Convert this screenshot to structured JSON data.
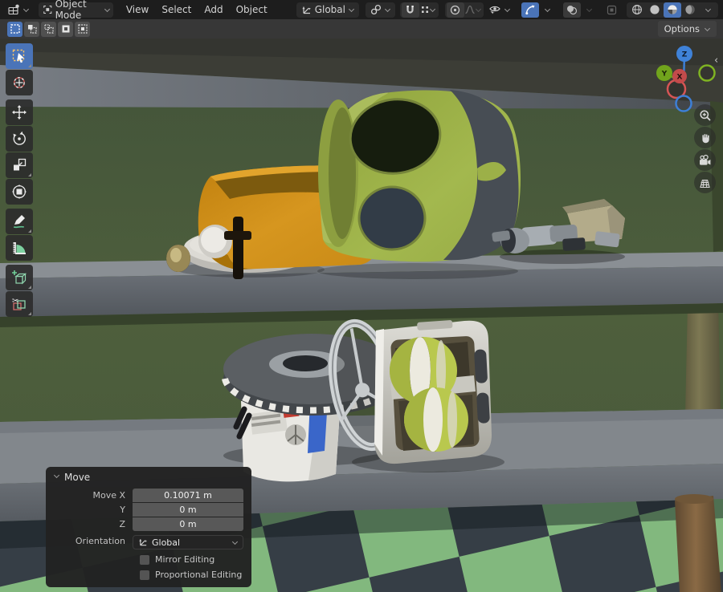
{
  "topbar": {
    "editor_icon": "3d-viewport-editor-icon",
    "mode_label": "Object Mode",
    "menus": [
      "View",
      "Select",
      "Add",
      "Object"
    ],
    "orientation_label": "Global",
    "icons": [
      "transform-orientation-icon",
      "snap-target-icon",
      "magnet-icon",
      "snap-individual-icon",
      "proportional-editing-icon",
      "falloff-curve-icon",
      "show-object-types-eye-icon",
      "gizmo-toggle-icon",
      "overlays-icon",
      "xray-toggle-icon",
      "shading-wireframe-icon",
      "shading-solid-icon",
      "shading-material-icon",
      "shading-rendered-icon"
    ]
  },
  "toolrow": {
    "options_label": "Options",
    "select_modes": [
      "set",
      "extend",
      "subtract",
      "invert",
      "intersect"
    ],
    "active_mode": "set"
  },
  "left_toolbar": {
    "tools": [
      "select-box",
      "cursor",
      "move",
      "rotate",
      "scale",
      "transform",
      "annotate",
      "measure",
      "add-cube",
      "cut"
    ],
    "active_tool": "select-box"
  },
  "gizmo": {
    "x": "X",
    "y": "Y",
    "z": "Z",
    "colors": {
      "x": "#cf4b4b",
      "y": "#6fa21d",
      "z": "#3d7fd6"
    }
  },
  "nav": [
    "zoom",
    "pan",
    "camera-view",
    "toggle-ortho"
  ],
  "move_panel": {
    "title": "Move",
    "fields": [
      {
        "label": "Move X",
        "value": "0.10071 m"
      },
      {
        "label": "Y",
        "value": "0 m"
      },
      {
        "label": "Z",
        "value": "0 m"
      }
    ],
    "orientation": {
      "label": "Orientation",
      "value": "Global"
    },
    "checkboxes": [
      {
        "label": "Mirror Editing",
        "checked": false
      },
      {
        "label": "Proportional Editing",
        "checked": false
      }
    ]
  },
  "scene": {
    "objects": [
      "orange-cuff",
      "green-helmet",
      "metal-parts",
      "white-base-disc",
      "disc-robot",
      "ball-cage",
      "wood-pole"
    ],
    "colors": {
      "wall": "#4a5a39",
      "shelf": "#82878c",
      "checker_green": "#82b87e",
      "checker_dark": "#363e46",
      "helmet": "#9aae43",
      "cuff": "#d08f1e",
      "accent_blue": "#4a74b8"
    }
  }
}
